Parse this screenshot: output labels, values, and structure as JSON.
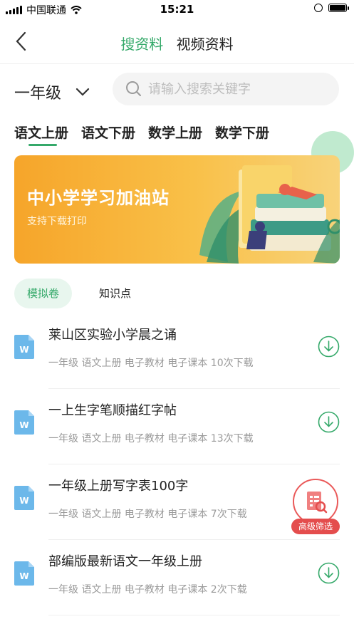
{
  "status_bar": {
    "carrier": "中国联通",
    "time": "15:21"
  },
  "nav": {
    "tabs": [
      {
        "label": "搜资料"
      },
      {
        "label": "视频资料"
      }
    ]
  },
  "grade": {
    "label": "一年级"
  },
  "search": {
    "placeholder": "请输入搜索关键字"
  },
  "categories": [
    {
      "label": "语文上册"
    },
    {
      "label": "语文下册"
    },
    {
      "label": "数学上册"
    },
    {
      "label": "数学下册"
    }
  ],
  "banner": {
    "title": "中小学学习加油站",
    "subtitle": "支持下载打印"
  },
  "subtabs": [
    {
      "label": "模拟卷"
    },
    {
      "label": "知识点"
    }
  ],
  "items": [
    {
      "title": "莱山区实验小学晨之诵",
      "meta": "一年级 语文上册 电子教材 电子课本 10次下载",
      "icon_letter": "W"
    },
    {
      "title": "一上生字笔顺描红字帖",
      "meta": "一年级 语文上册 电子教材 电子课本 13次下载",
      "icon_letter": "W"
    },
    {
      "title": "一年级上册写字表100字",
      "meta": "一年级 语文上册 电子教材 电子课本 7次下载",
      "icon_letter": "W"
    },
    {
      "title": "部编版最新语文一年级上册",
      "meta": "一年级 语文上册 电子教材 电子课本 2次下载",
      "icon_letter": "W"
    }
  ],
  "advanced_filter": {
    "label": "高级筛选"
  },
  "colors": {
    "accent": "#35a96a",
    "banner": "#f6a52a",
    "filter": "#e44d4d"
  }
}
